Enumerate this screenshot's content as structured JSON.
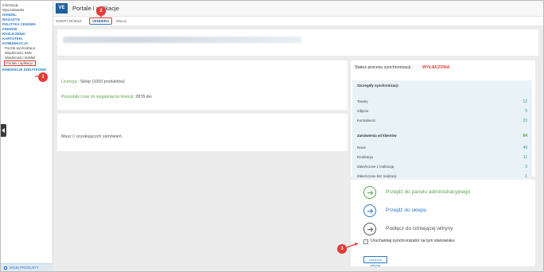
{
  "sidebar": {
    "items": [
      {
        "label": "Informacje",
        "kind": "plain"
      },
      {
        "label": "Wyszukiwarka",
        "kind": "plain"
      },
      {
        "label": "HANDEL",
        "kind": "cat"
      },
      {
        "label": "MAGAZYN",
        "kind": "cat"
      },
      {
        "label": "POLITYKA CENOWA",
        "kind": "cat"
      },
      {
        "label": "FINANSE",
        "kind": "cat"
      },
      {
        "label": "ROZLICZENIA",
        "kind": "cat"
      },
      {
        "label": "KARTOTEKI",
        "kind": "cat"
      },
      {
        "label": "KOMUNIKACJA",
        "kind": "cat"
      },
      {
        "label": "Poczta wychodząca",
        "kind": "sub"
      },
      {
        "label": "Wiadomości SMS",
        "kind": "sub"
      },
      {
        "label": "Wiadomości InsMail",
        "kind": "sub"
      },
      {
        "label": "Portale i aplikacje",
        "kind": "active"
      },
      {
        "label": "EWIDENCJE DODATKOWE",
        "kind": "cat"
      }
    ],
    "bottom_label": "MOJE PRODUKTY"
  },
  "header": {
    "logo": "VE",
    "title": "Portale i aplikacje"
  },
  "tabs": [
    {
      "label": "INSERT MOBILE",
      "active": false
    },
    {
      "label": "VENDERO",
      "active": true
    },
    {
      "label": "Więcej",
      "active": false
    }
  ],
  "license": {
    "label_prefix": "Licencja :",
    "label_value": "Sklep (1000 produktów)",
    "remaining_prefix": "Pozostały czas do wygaśnięcia licencji:",
    "remaining_value": "2878 dni"
  },
  "orders": {
    "prefix": "Masz",
    "count": "0",
    "suffix": "oczekujących zamówień."
  },
  "sync": {
    "status_label": "Status procesu synchronizacji :",
    "status_value": "WYŁĄCZONA",
    "details_header": "Szczegóły synchronizacji",
    "details": [
      {
        "label": "Towary",
        "value": "12"
      },
      {
        "label": "Zdjęcia",
        "value": "5"
      },
      {
        "label": "Kontrahenci",
        "value": "23"
      }
    ],
    "orders_header": "Zamówienia od klientów",
    "orders_total": "64",
    "orders": [
      {
        "label": "Nowe",
        "value": "49"
      },
      {
        "label": "Realizacja",
        "value": "11"
      },
      {
        "label": "Zakończone z realizacją",
        "value": "3"
      },
      {
        "label": "Zakończone bez realizacji",
        "value": "1"
      }
    ]
  },
  "actions": [
    {
      "label": "Przejdź do panelu administracyjnego",
      "color": "#5aa14b",
      "icon": "arrow-right-icon"
    },
    {
      "label": "Przejdź do sklepu",
      "color": "#2b78c5",
      "icon": "arrow-right-icon"
    },
    {
      "label": "Podłącz do istniejącej witryny",
      "color": "#555555",
      "icon": "arrow-right-icon"
    }
  ],
  "checkbox_label": "Uruchamiaj synchronizator na tym stanowisku",
  "run_button": "Uruchom witrynę",
  "callouts": [
    "1",
    "2",
    "3"
  ],
  "colors": {
    "accent": "#2b78c5",
    "logo": "#1f5f9e",
    "callout": "#e53935",
    "success": "#5aa14b"
  }
}
